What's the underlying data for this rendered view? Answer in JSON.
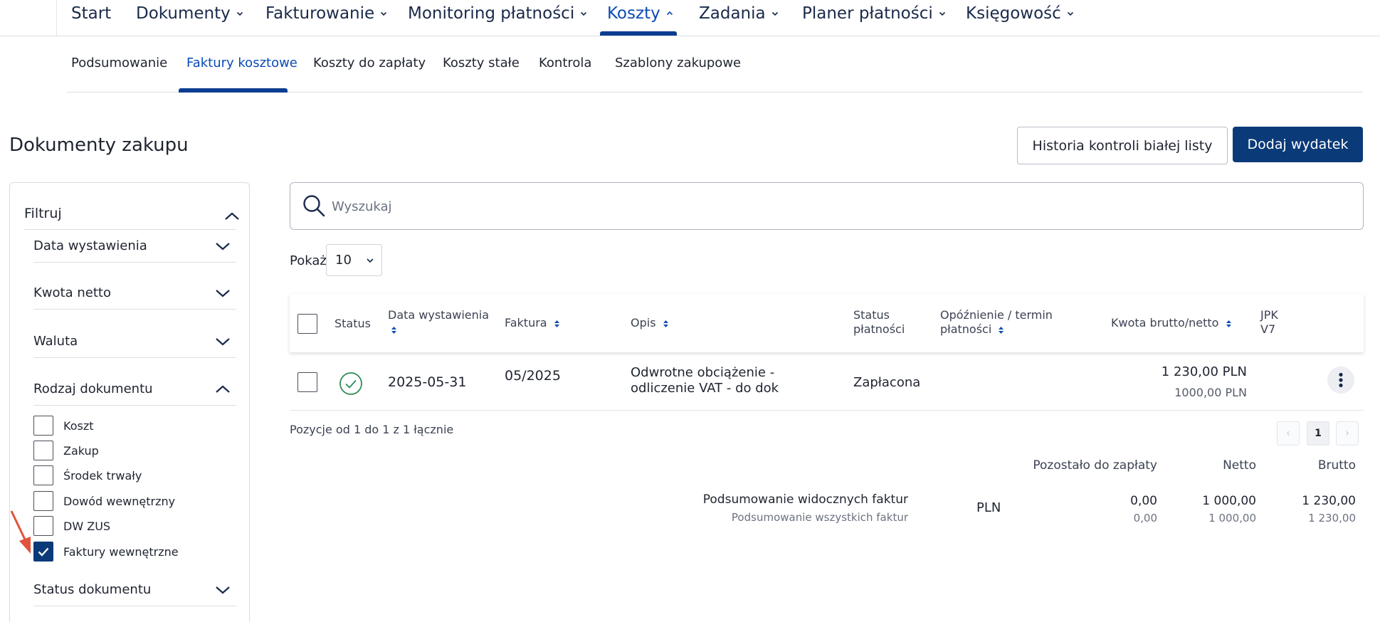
{
  "topnav": {
    "items": [
      {
        "label": "Start"
      },
      {
        "label": "Dokumenty"
      },
      {
        "label": "Fakturowanie"
      },
      {
        "label": "Monitoring płatności"
      },
      {
        "label": "Koszty"
      },
      {
        "label": "Zadania"
      },
      {
        "label": "Planer płatności"
      },
      {
        "label": "Księgowość"
      }
    ],
    "active": "Koszty"
  },
  "subnav": {
    "items": [
      {
        "label": "Podsumowanie"
      },
      {
        "label": "Faktury kosztowe"
      },
      {
        "label": "Koszty do zapłaty"
      },
      {
        "label": "Koszty stałe"
      },
      {
        "label": "Kontrola"
      },
      {
        "label": "Szablony zakupowe"
      }
    ],
    "active": "Faktury kosztowe"
  },
  "page": {
    "title": "Dokumenty zakupu",
    "history_button": "Historia kontroli białej listy",
    "add_button": "Dodaj wydatek"
  },
  "filter": {
    "title": "Filtruj",
    "sections": [
      {
        "label": "Data wystawienia"
      },
      {
        "label": "Kwota netto"
      },
      {
        "label": "Waluta"
      },
      {
        "label": "Rodzaj dokumentu"
      },
      {
        "label": "Status dokumentu"
      }
    ],
    "document_types": [
      {
        "label": "Koszt",
        "checked": false
      },
      {
        "label": "Zakup",
        "checked": false
      },
      {
        "label": "Środek trwały",
        "checked": false
      },
      {
        "label": "Dowód wewnętrzny",
        "checked": false
      },
      {
        "label": "DW ZUS",
        "checked": false
      },
      {
        "label": "Faktury wewnętrzne",
        "checked": true
      }
    ]
  },
  "search": {
    "placeholder": "Wyszukaj",
    "value": ""
  },
  "pagesize": {
    "label": "Pokaż",
    "value": "10"
  },
  "table": {
    "headers": {
      "status": "Status",
      "date": "Data wystawienia",
      "invoice": "Faktura",
      "description": "Opis",
      "payment_status_1": "Status",
      "payment_status_2": "płatności",
      "delay_1": "Opóźnienie / termin",
      "delay_2": "płatności",
      "amount": "Kwota brutto/netto",
      "jpk_1": "JPK",
      "jpk_2": "V7"
    },
    "rows": [
      {
        "date": "2025-05-31",
        "invoice": "05/2025",
        "description_1": "Odwrotne obciążenie -",
        "description_2": "odliczenie VAT - do dok",
        "payment_status": "Zapłacona",
        "gross": "1 230,00 PLN",
        "net": "1000,00 PLN"
      }
    ]
  },
  "pagination": {
    "summary": "Pozycje od 1 do 1 z 1 łącznie",
    "prev": "‹",
    "page": "1",
    "next": "›"
  },
  "summary": {
    "col_remaining": "Pozostało do zapłaty",
    "col_net": "Netto",
    "col_gross": "Brutto",
    "visible_label": "Podsumowanie widocznych faktur",
    "all_label": "Podsumowanie wszystkich faktur",
    "currency": "PLN",
    "visible_remaining": "0,00",
    "visible_net": "1 000,00",
    "visible_gross": "1 230,00",
    "all_remaining": "0,00",
    "all_net": "1 000,00",
    "all_gross": "1 230,00"
  },
  "colors": {
    "accent": "#0b3a78",
    "active_text": "#0b4bb3",
    "success": "#2e8b57",
    "annotation_arrow": "#e0533d"
  }
}
